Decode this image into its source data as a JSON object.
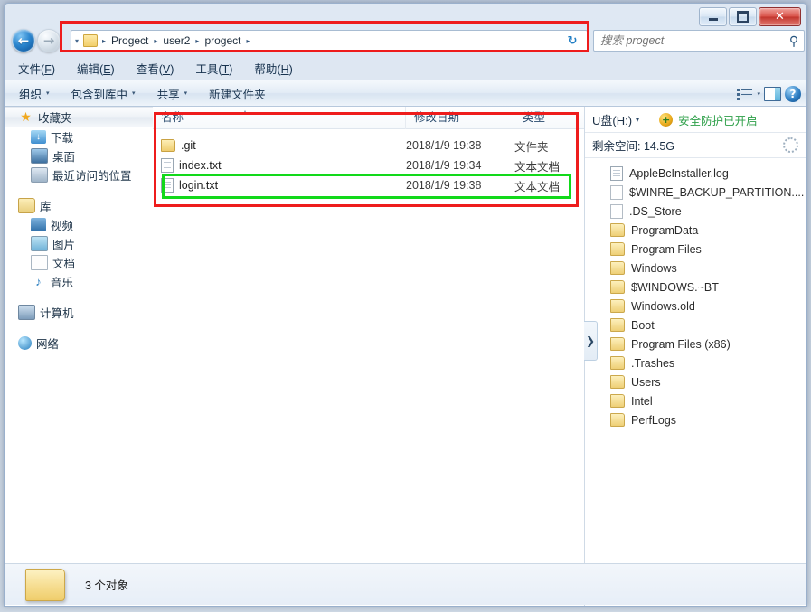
{
  "window": {
    "controls": {
      "minimize": "–",
      "maximize": "▭",
      "close": "✕"
    }
  },
  "address": {
    "back_icon": "←",
    "forward_icon": "→",
    "dropdown_icon": "▾",
    "folder_icon": "folder-icon",
    "crumbs": [
      "Progect",
      "user2",
      "progect"
    ],
    "separator": "▸",
    "refresh_icon": "↻",
    "search_placeholder": "搜索 progect",
    "search_value": "",
    "search_icon": "⚲"
  },
  "menubar": {
    "items": [
      {
        "label": "文件",
        "accel": "F"
      },
      {
        "label": "编辑",
        "accel": "E"
      },
      {
        "label": "查看",
        "accel": "V"
      },
      {
        "label": "工具",
        "accel": "T"
      },
      {
        "label": "帮助",
        "accel": "H"
      }
    ]
  },
  "toolbar": {
    "items": [
      {
        "label": "组织",
        "caret": "▾"
      },
      {
        "label": "包含到库中",
        "caret": "▾"
      },
      {
        "label": "共享",
        "caret": "▾"
      },
      {
        "label": "新建文件夹",
        "caret": ""
      }
    ],
    "views_caret": "▾",
    "help_glyph": "?"
  },
  "navpane": {
    "favorites": {
      "label": "收藏夹",
      "icon": "star-icon"
    },
    "favorite_items": [
      {
        "label": "下载",
        "icon": "downloads-icon"
      },
      {
        "label": "桌面",
        "icon": "desktop-icon"
      },
      {
        "label": "最近访问的位置",
        "icon": "recent-places-icon"
      }
    ],
    "libraries": {
      "label": "库",
      "icon": "library-icon"
    },
    "library_items": [
      {
        "label": "视频",
        "icon": "video-icon"
      },
      {
        "label": "图片",
        "icon": "pictures-icon"
      },
      {
        "label": "文档",
        "icon": "documents-icon"
      },
      {
        "label": "音乐",
        "icon": "music-icon"
      }
    ],
    "computer": {
      "label": "计算机",
      "icon": "computer-icon"
    },
    "network": {
      "label": "网络",
      "icon": "network-icon"
    }
  },
  "filelist": {
    "columns": [
      "名称",
      "修改日期",
      "类型"
    ],
    "sort_indicator": "▴",
    "rows": [
      {
        "name": ".git",
        "date": "2018/1/9 19:38",
        "type": "文件夹",
        "icon": "folder-icon"
      },
      {
        "name": "index.txt",
        "date": "2018/1/9 19:34",
        "type": "文本文档",
        "icon": "text-file-icon"
      },
      {
        "name": "login.txt",
        "date": "2018/1/9 19:38",
        "type": "文本文档",
        "icon": "text-file-icon"
      }
    ],
    "scroll_left_arrow": "◂",
    "scroll_right_arrow": "▸",
    "scroll_grip": "⦀"
  },
  "usbpanel": {
    "drive_label": "U盘(H:)",
    "drive_dropdown": "▾",
    "security_text": "安全防护已开启",
    "security_icon": "shield-plus-icon",
    "security_glyph": "+",
    "free_space": "剩余空间: 14.5G",
    "settings_icon": "gear-icon",
    "expander_glyph": "❯",
    "items": [
      {
        "label": "AppleBcInstaller.log",
        "icon": "log-file-icon"
      },
      {
        "label": "$WINRE_BACKUP_PARTITION....",
        "icon": "file-icon"
      },
      {
        "label": ".DS_Store",
        "icon": "file-icon"
      },
      {
        "label": "ProgramData",
        "icon": "folder-icon"
      },
      {
        "label": "Program Files",
        "icon": "folder-icon"
      },
      {
        "label": "Windows",
        "icon": "folder-icon"
      },
      {
        "label": "$WINDOWS.~BT",
        "icon": "folder-icon"
      },
      {
        "label": "Windows.old",
        "icon": "folder-icon"
      },
      {
        "label": "Boot",
        "icon": "folder-icon"
      },
      {
        "label": "Program Files (x86)",
        "icon": "folder-icon"
      },
      {
        "label": ".Trashes",
        "icon": "folder-icon"
      },
      {
        "label": "Users",
        "icon": "folder-icon"
      },
      {
        "label": "Intel",
        "icon": "folder-icon"
      },
      {
        "label": "PerfLogs",
        "icon": "folder-icon"
      }
    ]
  },
  "statusbar": {
    "item_count": "3 个对象",
    "folder_icon": "folder-icon"
  },
  "annotations": {
    "colors": {
      "address_box": "#ee1c1c",
      "list_box": "#ee1c1c",
      "selected_row_box": "#12d91a"
    }
  }
}
